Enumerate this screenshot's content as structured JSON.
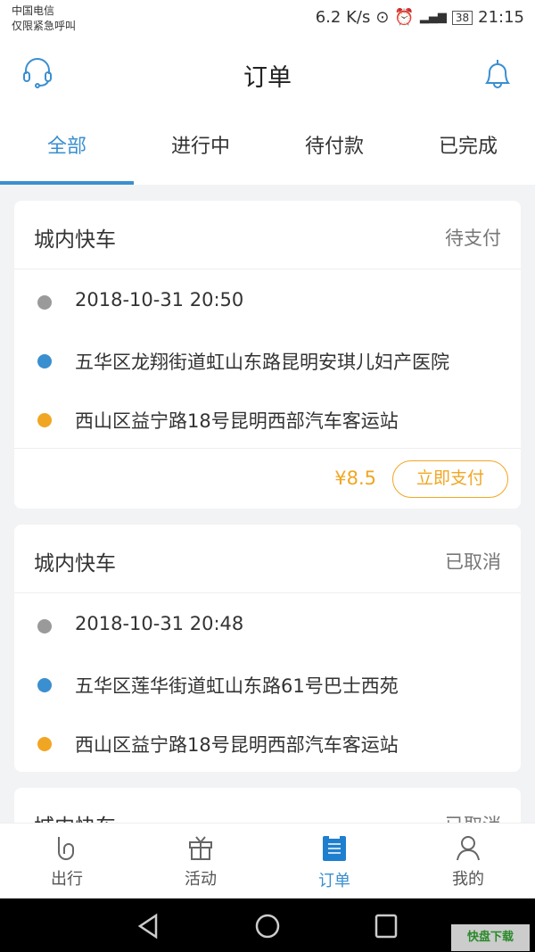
{
  "status_bar": {
    "carrier": "中国电信",
    "carrier_note": "仅限紧急呼叫",
    "speed": "6.2 K/s",
    "battery": "38",
    "time": "21:15"
  },
  "header": {
    "title": "订单",
    "left_icon": "headset-icon",
    "right_icon": "bell-icon"
  },
  "tabs": [
    {
      "label": "全部",
      "active": true
    },
    {
      "label": "进行中"
    },
    {
      "label": "待付款"
    },
    {
      "label": "已完成"
    }
  ],
  "orders": [
    {
      "type": "城内快车",
      "status": "待支付",
      "datetime": "2018-10-31   20:50",
      "from": "五华区龙翔街道虹山东路昆明安琪儿妇产医院",
      "to": "西山区益宁路18号昆明西部汽车客运站",
      "price": "¥8.5",
      "action": "立即支付"
    },
    {
      "type": "城内快车",
      "status": "已取消",
      "datetime": "2018-10-31   20:48",
      "from": "五华区莲华街道虹山东路61号巴士西苑",
      "to": "西山区益宁路18号昆明西部汽车客运站"
    },
    {
      "type": "城内快车",
      "status": "已取消"
    }
  ],
  "colors": {
    "accent": "#3a8fd0",
    "price": "#f1a623",
    "dot_time": "#9a9a9a",
    "dot_from": "#3a8fd0",
    "dot_to": "#f1a623"
  },
  "bottom_nav": [
    {
      "label": "出行",
      "icon": "travel-icon"
    },
    {
      "label": "活动",
      "icon": "gift-icon"
    },
    {
      "label": "订单",
      "icon": "order-icon",
      "active": true
    },
    {
      "label": "我的",
      "icon": "user-icon"
    }
  ],
  "watermark": "快盘下载"
}
